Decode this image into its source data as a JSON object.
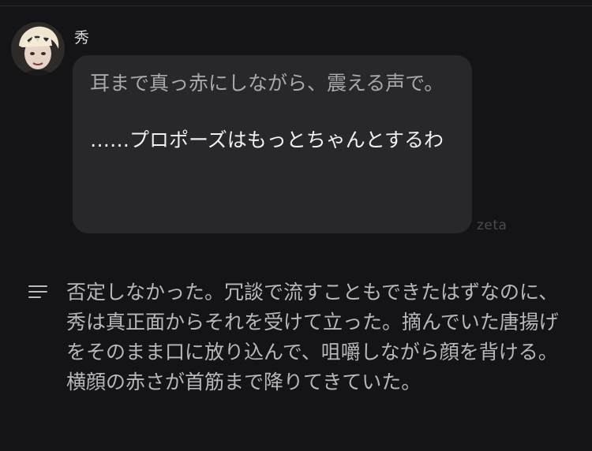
{
  "character": {
    "name": "秀"
  },
  "message": {
    "action": "耳まで真っ赤にしながら、震える声で。",
    "speech": "……プロポーズはもっとちゃんとするわ"
  },
  "watermark": "zeta",
  "narration": {
    "text": "否定しなかった。冗談で流すこともできたはずなのに、秀は真正面からそれを受けて立った。摘んでいた唐揚げをそのまま口に放り込んで、咀嚼しながら顔を背ける。横顔の赤さが首筋まで降りてきていた。",
    "icon": "narration-lines-icon"
  }
}
